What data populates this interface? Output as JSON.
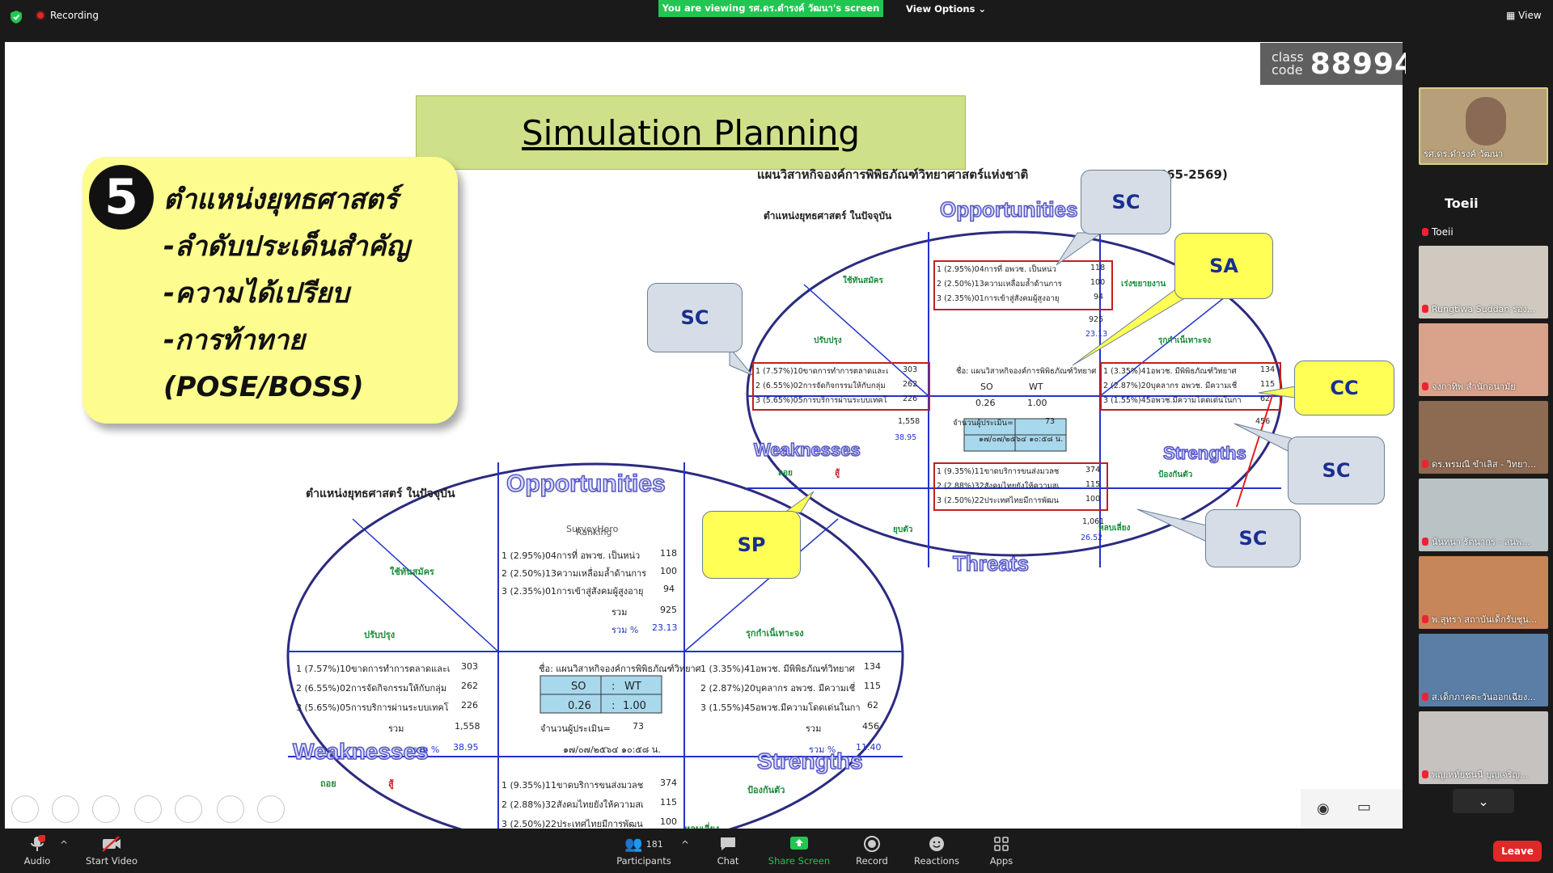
{
  "topbar": {
    "recording": "Recording",
    "viewing_banner": "You are viewing รศ.ดร.ดำรงค์ วัฒนา's screen",
    "view_options": "View Options",
    "view": "View"
  },
  "class_code": {
    "label_line1": "class",
    "label_line2": "code",
    "value": "88994"
  },
  "slide": {
    "title": "Simulation Planning",
    "main_heading": "แผนวิสาหกิจองค์การพิพิธภัณฑ์วิทยาศาสตร์แห่งชาติ",
    "main_heading_tail": "ศ.2565-2569)",
    "yellow_box": {
      "number": "5",
      "lines": [
        "ตำแหน่งยุทธศาสตร์",
        "-ลำดับประเด็นสำคัญ",
        "-ความได้เปรียบ",
        "-การท้าทาย",
        "(POSE/BOSS)"
      ]
    },
    "callouts": {
      "sc1": "SC",
      "sa": "SA",
      "sc2": "SC",
      "cc": "CC",
      "sc3": "SC",
      "sc4": "SC",
      "sp": "SP"
    },
    "diagram": {
      "position_label": "ตำแหน่งยุทธศาสตร์ ในปัจจุบัน",
      "opportunities": "Opportunities",
      "weaknesses": "Weaknesses",
      "strengths": "Strengths",
      "threats": "Threats",
      "survey": "SurveyHero",
      "ranking": "Ranking",
      "q_use": "ใช้ทันสมัคร",
      "q_improve": "ปรับปรุง",
      "q_attack": "รุกกำเน็เทาะจง",
      "q_speed": "เร่งขยายงาน",
      "q_defend": "ป้องกันตัว",
      "q_avoid": "หลบเลี่ยง",
      "q_retreat": "ถอย",
      "q_fight": "สู้",
      "q_yield": "ยุบตัว",
      "opp_rows": [
        {
          "text": "1 (2.95%)04การที่ อพวช. เป็นหน่ว",
          "val": "118"
        },
        {
          "text": "2 (2.50%)13ความเหลื่อมล้ำด้านการ",
          "val": "100"
        },
        {
          "text": "3 (2.35%)01การเข้าสู่สังคมผู้สูงอายุ",
          "val": "94"
        }
      ],
      "opp_sum": "925",
      "opp_pct": "23.13",
      "weak_rows": [
        {
          "text": "1 (7.57%)10ขาดการทำการตลาดและเ",
          "val": "303"
        },
        {
          "text": "2 (6.55%)02การจัดกิจกรรมให้กับกลุ่ม",
          "val": "262"
        },
        {
          "text": "3 (5.65%)05การบริการผ่านระบบเทคโ",
          "val": "226"
        }
      ],
      "weak_sum": "1,558",
      "weak_pct": "38.95",
      "str_rows": [
        {
          "text": "1 (3.35%)41อพวช. มีพิพิธภัณฑ์วิทยาศ",
          "val": "134"
        },
        {
          "text": "2 (2.87%)20บุคลากร อพวช. มีความเชี่",
          "val": "115"
        },
        {
          "text": "3 (1.55%)45อพวช.มีความโดดเด่นในกา",
          "val": "62"
        }
      ],
      "str_sum": "456",
      "str_pct": "11.40",
      "thr_rows": [
        {
          "text": "1 (9.35%)11ขาดบริการขนส่งมวลช",
          "val": "374"
        },
        {
          "text": "2 (2.88%)32สังคมไทยยังให้ความสเ",
          "val": "115"
        },
        {
          "text": "3 (2.50%)22ประเทศไทยมีการพัฒน",
          "val": "100"
        }
      ],
      "thr_sum": "1,061",
      "thr_pct": "26.52",
      "sum_label": "รวม",
      "pct_label": "รวม %",
      "pct_sign": "%",
      "org_name": "ชื่อ: แผนวิสาหกิจองค์การพิพิธภัณฑ์วิทยาศ",
      "so": "SO",
      "colon": ":",
      "wt": "WT",
      "ratio_a": "0.26",
      "ratio_b": "1.00",
      "respondents_label": "จำนวนผู้ประเมิน=",
      "respondents": "73",
      "date": "๑๗/๐๗/๒๕๖๔ ๑๐:๕๘ น."
    }
  },
  "participants_panel": {
    "featured_name": "รศ.ดร.ดำรงค์ วัฒนา",
    "toeii_big": "Toeii",
    "toeii_small": "Toeii",
    "tiles": [
      "Rungtiwa Suddan รอง...",
      "จงกาทิพ สำนักอนามัย",
      "ดร.พรมณี ขำเลิส - วิทยา...",
      "นันทนา รัตนากร - สนพ...",
      "พ.สุทรา สถาบันเด็กรับชุน...",
      "ส.เด็กภาคตะวันออกเฉียง...",
      "พญ.หทัยชนนี บุญเจริญ..."
    ]
  },
  "bottom": {
    "audio": "Audio",
    "start_video": "Start Video",
    "participants": "Participants",
    "participants_count": "181",
    "chat": "Chat",
    "share_screen": "Share Screen",
    "record": "Record",
    "reactions": "Reactions",
    "apps": "Apps",
    "leave": "Leave",
    "audio_badge": "!"
  }
}
